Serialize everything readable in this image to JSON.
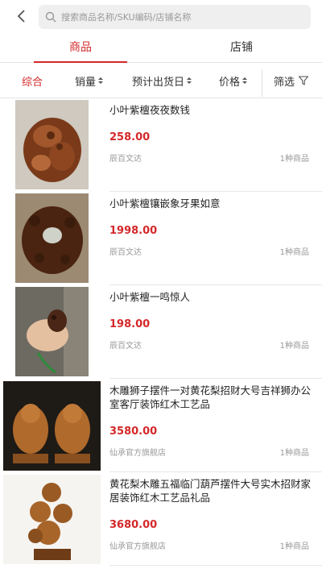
{
  "search": {
    "placeholder": "搜索商品名称/SKU编码/店铺名称"
  },
  "tabs": [
    {
      "label": "商品",
      "active": true
    },
    {
      "label": "店铺",
      "active": false
    }
  ],
  "sort": {
    "comprehensive": "综合",
    "sales": "销量",
    "ship_date": "预计出货日",
    "price": "价格",
    "filter": "筛选"
  },
  "colors": {
    "accent": "#d4282a",
    "muted": "#9a9a9a"
  },
  "products": [
    {
      "title": "小叶紫檀夜夜数钱",
      "price": "258.00",
      "shop": "辰百文达",
      "count": "1种商品"
    },
    {
      "title": "小叶紫檀镶嵌象牙果如意",
      "price": "1998.00",
      "shop": "辰百文达",
      "count": "1种商品"
    },
    {
      "title": "小叶紫檀一鸣惊人",
      "price": "198.00",
      "shop": "辰百文达",
      "count": "1种商品"
    },
    {
      "title": "木雕狮子摆件一对黄花梨招财大号吉祥狮办公室客厅装饰红木工艺品",
      "price": "3580.00",
      "shop": "仙承官方旗舰店",
      "count": "1种商品"
    },
    {
      "title": "黄花梨木雕五福临门葫芦摆件大号实木招财家居装饰红木工艺品礼品",
      "price": "3680.00",
      "shop": "仙承官方旗舰店",
      "count": "1种商品"
    }
  ]
}
